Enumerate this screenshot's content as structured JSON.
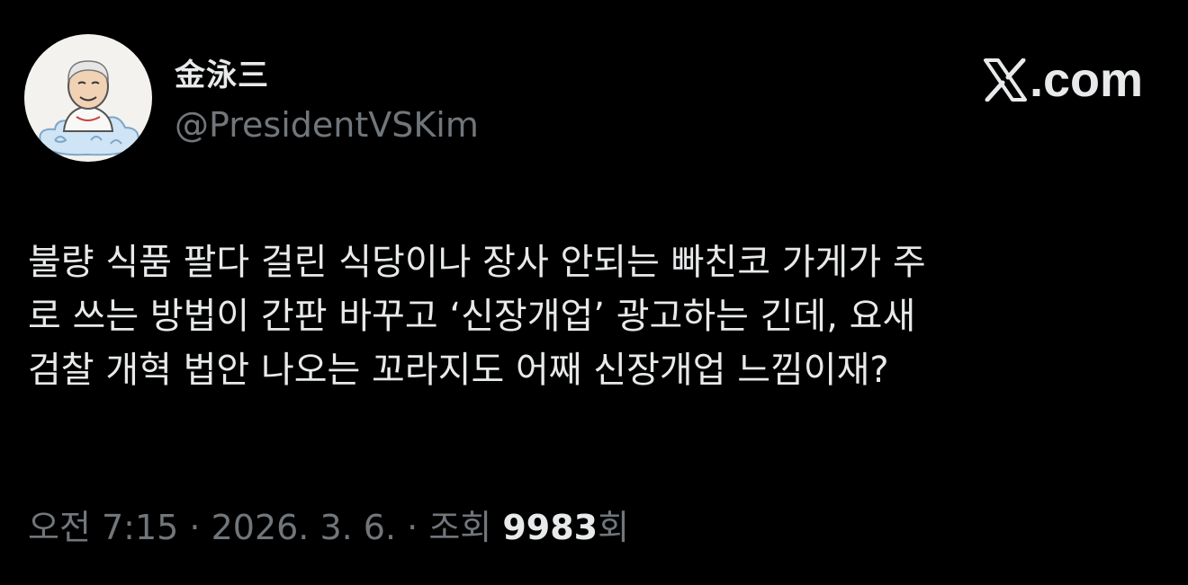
{
  "author": {
    "display_name": "金泳三",
    "handle": "@PresidentVSKim",
    "avatar_icon": "cartoon-portrait-avatar"
  },
  "brand": {
    "icon": "x-logo-icon",
    "suffix": ".com"
  },
  "tweet": {
    "lines": [
      "불량 식품 팔다 걸린 식당이나 장사 안되는 빠친코 가게가 주",
      "로 쓰는 방법이 간판 바꾸고 ‘신장개업’ 광고하는 긴데, 요새",
      "검찰 개혁 법안 나오는 꼬라지도 어째 신장개업 느낌이재?"
    ]
  },
  "meta": {
    "time": "오전 7:15",
    "sep1": " · ",
    "date": "2026. 3. 6.",
    "sep2": " · ",
    "views_label": "조회 ",
    "views_count": "9983",
    "views_suffix": "회"
  },
  "colors": {
    "background": "#000000",
    "primary_text": "#e7e9ea",
    "secondary_text": "#71767b"
  }
}
